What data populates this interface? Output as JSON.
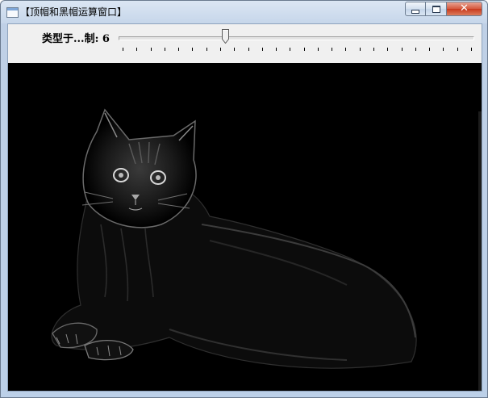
{
  "window": {
    "title": "【顶帽和黑帽运算窗口】",
    "min_symbol": "",
    "max_symbol": "",
    "close_symbol": "✕"
  },
  "trackbar": {
    "label": "类型于...制: 6",
    "value_fraction": 0.3,
    "tick_count": 26
  },
  "image": {
    "description_icon": "cat-image"
  },
  "colors": {
    "background": "#000000",
    "toolbar": "#f0f0f0",
    "frame": "#bfd0e6",
    "close": "#c8381c"
  }
}
